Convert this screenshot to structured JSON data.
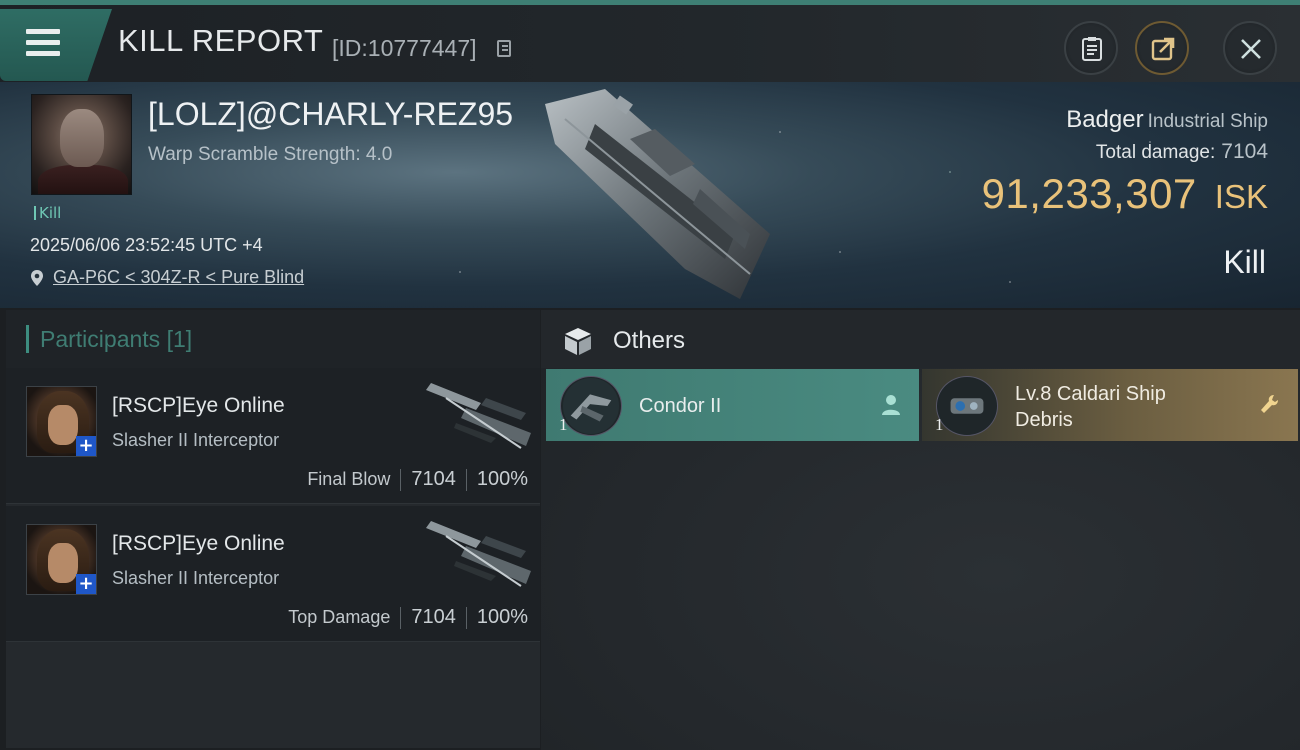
{
  "header": {
    "title": "KILL REPORT",
    "report_id": "[ID:10777447]",
    "colors": {
      "accent": "#3e7f74",
      "isk": "#e9c27a"
    }
  },
  "victim": {
    "name": "[LOLZ]@CHARLY-REZ95",
    "warp_scramble": "Warp Scramble Strength: 4.0",
    "kill_tag": "Kill",
    "datetime": "2025/06/06 23:52:45 UTC +4",
    "location": "GA-P6C < 304Z-R < Pure Blind",
    "ship_name": "Badger",
    "ship_class": "Industrial Ship",
    "total_damage_label": "Total damage:",
    "total_damage_value": "7104",
    "isk_value": "91,233,307",
    "isk_unit": "ISK",
    "result": "Kill"
  },
  "participants": {
    "title": "Participants",
    "count": "[1]",
    "rows": [
      {
        "name": "[RSCP]Eye Online",
        "ship": "Slasher II Interceptor",
        "tag": "Final Blow",
        "damage": "7104",
        "percent": "100%"
      },
      {
        "name": "[RSCP]Eye Online",
        "ship": "Slasher II Interceptor",
        "tag": "Top Damage",
        "damage": "7104",
        "percent": "100%"
      }
    ]
  },
  "others": {
    "title": "Others",
    "items": [
      {
        "name": "Condor II",
        "qty": "1",
        "action_icon": "person-icon"
      },
      {
        "name_line1": "Lv.8 Caldari Ship",
        "name_line2": "Debris",
        "qty": "1",
        "action_icon": "wrench-icon"
      }
    ]
  }
}
